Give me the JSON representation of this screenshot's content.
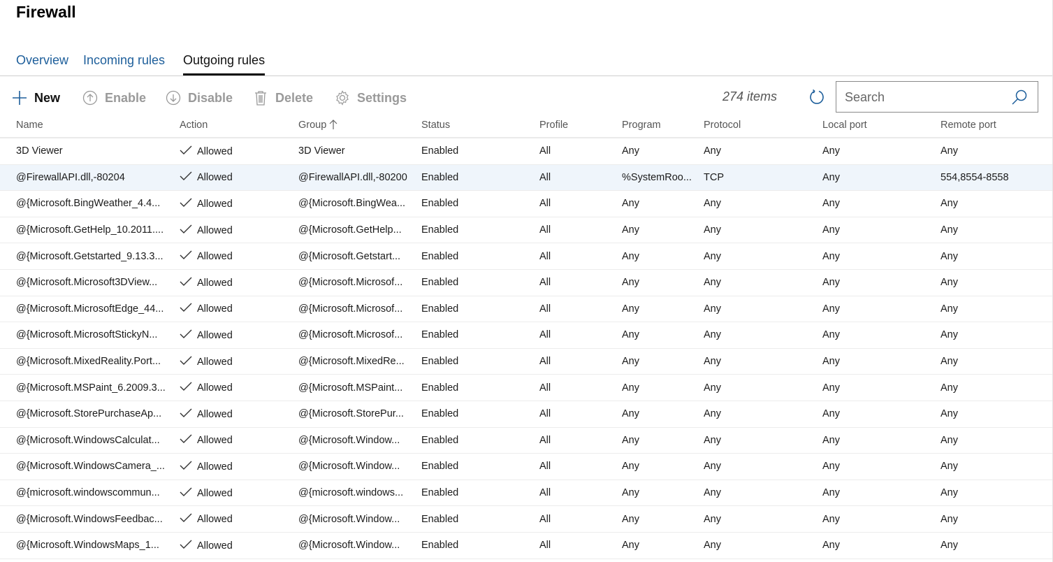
{
  "page": {
    "title": "Firewall"
  },
  "tabs": [
    {
      "label": "Overview",
      "active": false
    },
    {
      "label": "Incoming rules",
      "active": false
    },
    {
      "label": "Outgoing rules",
      "active": true
    }
  ],
  "toolbar": {
    "new_label": "New",
    "enable_label": "Enable",
    "disable_label": "Disable",
    "delete_label": "Delete",
    "settings_label": "Settings",
    "item_count": "274 items",
    "search_placeholder": "Search",
    "search_value": ""
  },
  "colors": {
    "accent": "#1e5f9b",
    "selected_row": "#eff5fb",
    "disabled": "#9a9a9a"
  },
  "table": {
    "columns": [
      "Name",
      "Action",
      "Group",
      "Status",
      "Profile",
      "Program",
      "Protocol",
      "Local port",
      "Remote port"
    ],
    "sort": {
      "column": "Group",
      "direction": "ascending"
    },
    "rows": [
      [
        "3D Viewer",
        "Allowed",
        "3D Viewer",
        "Enabled",
        "All",
        "Any",
        "Any",
        "Any",
        "Any"
      ],
      [
        "@FirewallAPI.dll,-80204",
        "Allowed",
        "@FirewallAPI.dll,-80200",
        "Enabled",
        "All",
        "%SystemRoo...",
        "TCP",
        "Any",
        "554,8554-8558"
      ],
      [
        "@{Microsoft.BingWeather_4.4...",
        "Allowed",
        "@{Microsoft.BingWea...",
        "Enabled",
        "All",
        "Any",
        "Any",
        "Any",
        "Any"
      ],
      [
        "@{Microsoft.GetHelp_10.2011....",
        "Allowed",
        "@{Microsoft.GetHelp...",
        "Enabled",
        "All",
        "Any",
        "Any",
        "Any",
        "Any"
      ],
      [
        "@{Microsoft.Getstarted_9.13.3...",
        "Allowed",
        "@{Microsoft.Getstart...",
        "Enabled",
        "All",
        "Any",
        "Any",
        "Any",
        "Any"
      ],
      [
        "@{Microsoft.Microsoft3DView...",
        "Allowed",
        "@{Microsoft.Microsof...",
        "Enabled",
        "All",
        "Any",
        "Any",
        "Any",
        "Any"
      ],
      [
        "@{Microsoft.MicrosoftEdge_44...",
        "Allowed",
        "@{Microsoft.Microsof...",
        "Enabled",
        "All",
        "Any",
        "Any",
        "Any",
        "Any"
      ],
      [
        "@{Microsoft.MicrosoftStickyN...",
        "Allowed",
        "@{Microsoft.Microsof...",
        "Enabled",
        "All",
        "Any",
        "Any",
        "Any",
        "Any"
      ],
      [
        "@{Microsoft.MixedReality.Port...",
        "Allowed",
        "@{Microsoft.MixedRe...",
        "Enabled",
        "All",
        "Any",
        "Any",
        "Any",
        "Any"
      ],
      [
        "@{Microsoft.MSPaint_6.2009.3...",
        "Allowed",
        "@{Microsoft.MSPaint...",
        "Enabled",
        "All",
        "Any",
        "Any",
        "Any",
        "Any"
      ],
      [
        "@{Microsoft.StorePurchaseAp...",
        "Allowed",
        "@{Microsoft.StorePur...",
        "Enabled",
        "All",
        "Any",
        "Any",
        "Any",
        "Any"
      ],
      [
        "@{Microsoft.WindowsCalculat...",
        "Allowed",
        "@{Microsoft.Window...",
        "Enabled",
        "All",
        "Any",
        "Any",
        "Any",
        "Any"
      ],
      [
        "@{Microsoft.WindowsCamera_...",
        "Allowed",
        "@{Microsoft.Window...",
        "Enabled",
        "All",
        "Any",
        "Any",
        "Any",
        "Any"
      ],
      [
        "@{microsoft.windowscommun...",
        "Allowed",
        "@{microsoft.windows...",
        "Enabled",
        "All",
        "Any",
        "Any",
        "Any",
        "Any"
      ],
      [
        "@{Microsoft.WindowsFeedbac...",
        "Allowed",
        "@{Microsoft.Window...",
        "Enabled",
        "All",
        "Any",
        "Any",
        "Any",
        "Any"
      ],
      [
        "@{Microsoft.WindowsMaps_1...",
        "Allowed",
        "@{Microsoft.Window...",
        "Enabled",
        "All",
        "Any",
        "Any",
        "Any",
        "Any"
      ]
    ],
    "selected_row_index": 1
  }
}
